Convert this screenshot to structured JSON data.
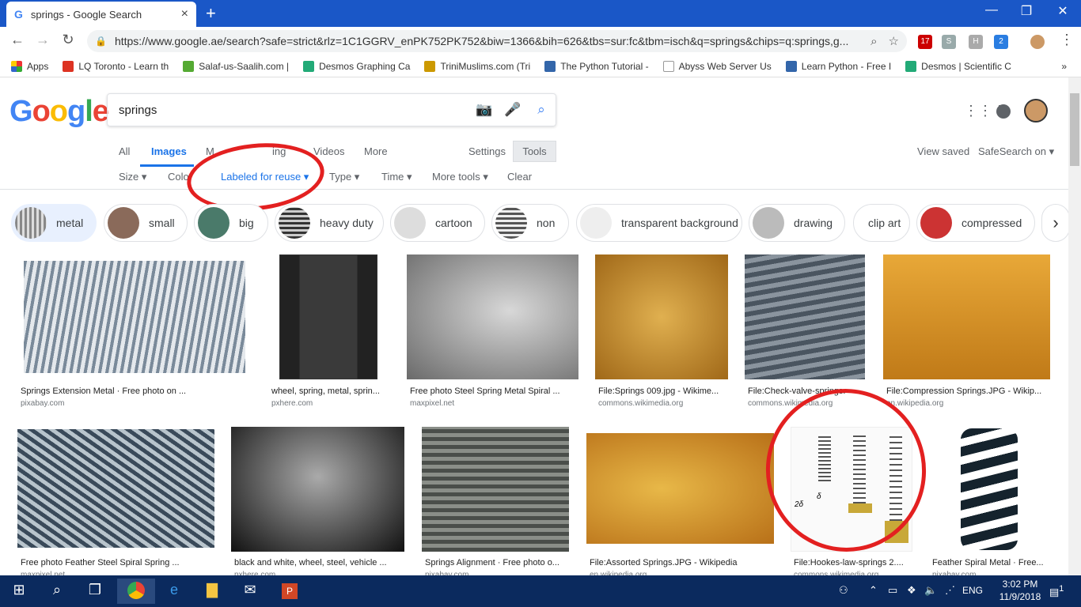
{
  "browser": {
    "tab_title": "springs - Google Search",
    "tab_close": "×",
    "new_tab": "+",
    "url": "https://www.google.ae/search?safe=strict&rlz=1C1GGRV_enPK752PK752&biw=1366&bih=626&tbs=sur:fc&tbm=isch&q=springs&chips=q:springs,g...",
    "ext_badges": [
      "17",
      "2"
    ]
  },
  "bookmarks": [
    {
      "label": "Apps",
      "color": "#e33"
    },
    {
      "label": "LQ Toronto - Learn th",
      "color": "#d32"
    },
    {
      "label": "Salaf-us-Saalih.com |",
      "color": "#5a3"
    },
    {
      "label": "Desmos Graphing Ca",
      "color": "#2a7"
    },
    {
      "label": "TriniMuslims.com (Tri",
      "color": "#c90"
    },
    {
      "label": "The Python Tutorial -",
      "color": "#36a"
    },
    {
      "label": "Abyss Web Server Us",
      "color": "#999"
    },
    {
      "label": "Learn Python - Free I",
      "color": "#36a"
    },
    {
      "label": "Desmos | Scientific C",
      "color": "#2a7"
    }
  ],
  "bookmarks_more": "»",
  "search": {
    "query": "springs"
  },
  "tabs": {
    "all": "All",
    "images": "Images",
    "maps": "M",
    "shopping": "ing",
    "videos": "Videos",
    "more": "More",
    "settings": "Settings",
    "tools": "Tools"
  },
  "tools": {
    "size": "Size",
    "color": "Colo",
    "license": "Labeled for reuse",
    "type": "Type",
    "time": "Time",
    "more_tools": "More tools",
    "clear": "Clear"
  },
  "header_right": {
    "view_saved": "View saved",
    "safesearch": "SafeSearch on"
  },
  "chips": [
    "metal",
    "small",
    "big",
    "heavy duty",
    "cartoon",
    "non",
    "transparent background",
    "drawing",
    "clip art",
    "compressed"
  ],
  "images_row1": [
    {
      "caption": "Springs Extension Metal · Free photo on ...",
      "source": "pixabay.com"
    },
    {
      "caption": "wheel, spring, metal, sprin...",
      "source": "pxhere.com"
    },
    {
      "caption": "Free photo Steel Spring Metal Spiral ...",
      "source": "maxpixel.net"
    },
    {
      "caption": "File:Springs 009.jpg - Wikime...",
      "source": "commons.wikimedia.org"
    },
    {
      "caption": "File:Check-valve-springs...",
      "source": "commons.wikimedia.org"
    },
    {
      "caption": "File:Compression Springs.JPG - Wikip...",
      "source": "en.wikipedia.org"
    }
  ],
  "images_row2": [
    {
      "caption": "Free photo Feather Steel Spiral Spring ...",
      "source": "maxpixel.net"
    },
    {
      "caption": "black and white, wheel, steel, vehicle ...",
      "source": "pxhere.com"
    },
    {
      "caption": "Springs Alignment · Free photo o...",
      "source": "pixabay.com"
    },
    {
      "caption": "File:Assorted Springs.JPG - Wikipedia",
      "source": "en.wikipedia.org"
    },
    {
      "caption": "File:Hookes-law-springs 2....",
      "source": "commons.wikimedia.org"
    },
    {
      "caption": "Feather Spiral Metal · Free...",
      "source": "pixabay.com"
    }
  ],
  "diagram_labels": {
    "d1": "δ",
    "d2": "2δ"
  },
  "taskbar": {
    "lang": "ENG",
    "time": "3:02 PM",
    "date": "11/9/2018",
    "notif": "1"
  },
  "colors": {
    "accent": "#1a73e8",
    "titlebar": "#1a57c7",
    "annotation": "#e32020"
  }
}
